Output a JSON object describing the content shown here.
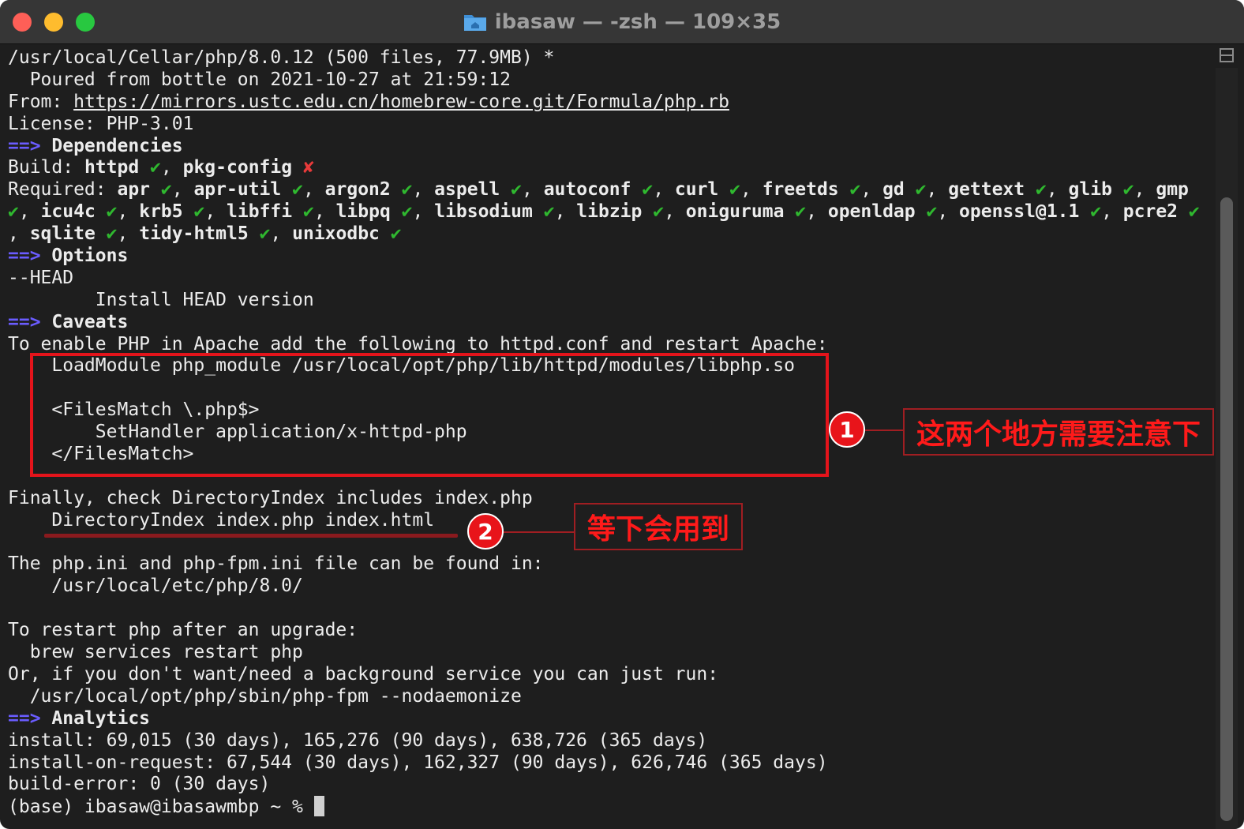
{
  "window": {
    "title": "ibasaw — -zsh — 109×35"
  },
  "terminal": {
    "lines": [
      [
        {
          "t": "/usr/local/Cellar/php/8.0.12 (500 files, 77.9MB) *"
        }
      ],
      [
        {
          "t": "  Poured from bottle on 2021-10-27 at 21:59:12"
        }
      ],
      [
        {
          "t": "From: "
        },
        {
          "t": "https://mirrors.ustc.edu.cn/homebrew-core.git/Formula/php.rb",
          "c": "u"
        }
      ],
      [
        {
          "t": "License: PHP-3.01"
        }
      ],
      [
        {
          "t": "==>",
          "c": "arrow"
        },
        {
          "t": " Dependencies",
          "c": "b"
        }
      ],
      [
        {
          "t": "Build: "
        },
        {
          "t": "httpd",
          "c": "b"
        },
        {
          "t": " "
        },
        {
          "t": "✔",
          "c": "ok"
        },
        {
          "t": ", "
        },
        {
          "t": "pkg-config",
          "c": "b"
        },
        {
          "t": " "
        },
        {
          "t": "✘",
          "c": "x"
        }
      ],
      [
        {
          "t": "Required: "
        },
        {
          "t": "apr",
          "c": "b"
        },
        {
          "t": " "
        },
        {
          "t": "✔",
          "c": "ok"
        },
        {
          "t": ", "
        },
        {
          "t": "apr-util",
          "c": "b"
        },
        {
          "t": " "
        },
        {
          "t": "✔",
          "c": "ok"
        },
        {
          "t": ", "
        },
        {
          "t": "argon2",
          "c": "b"
        },
        {
          "t": " "
        },
        {
          "t": "✔",
          "c": "ok"
        },
        {
          "t": ", "
        },
        {
          "t": "aspell",
          "c": "b"
        },
        {
          "t": " "
        },
        {
          "t": "✔",
          "c": "ok"
        },
        {
          "t": ", "
        },
        {
          "t": "autoconf",
          "c": "b"
        },
        {
          "t": " "
        },
        {
          "t": "✔",
          "c": "ok"
        },
        {
          "t": ", "
        },
        {
          "t": "curl",
          "c": "b"
        },
        {
          "t": " "
        },
        {
          "t": "✔",
          "c": "ok"
        },
        {
          "t": ", "
        },
        {
          "t": "freetds",
          "c": "b"
        },
        {
          "t": " "
        },
        {
          "t": "✔",
          "c": "ok"
        },
        {
          "t": ", "
        },
        {
          "t": "gd",
          "c": "b"
        },
        {
          "t": " "
        },
        {
          "t": "✔",
          "c": "ok"
        },
        {
          "t": ", "
        },
        {
          "t": "gettext",
          "c": "b"
        },
        {
          "t": " "
        },
        {
          "t": "✔",
          "c": "ok"
        },
        {
          "t": ", "
        },
        {
          "t": "glib",
          "c": "b"
        },
        {
          "t": " "
        },
        {
          "t": "✔",
          "c": "ok"
        },
        {
          "t": ", "
        },
        {
          "t": "gmp",
          "c": "b"
        }
      ],
      [
        {
          "t": "✔",
          "c": "ok"
        },
        {
          "t": ", "
        },
        {
          "t": "icu4c",
          "c": "b"
        },
        {
          "t": " "
        },
        {
          "t": "✔",
          "c": "ok"
        },
        {
          "t": ", "
        },
        {
          "t": "krb5",
          "c": "b"
        },
        {
          "t": " "
        },
        {
          "t": "✔",
          "c": "ok"
        },
        {
          "t": ", "
        },
        {
          "t": "libffi",
          "c": "b"
        },
        {
          "t": " "
        },
        {
          "t": "✔",
          "c": "ok"
        },
        {
          "t": ", "
        },
        {
          "t": "libpq",
          "c": "b"
        },
        {
          "t": " "
        },
        {
          "t": "✔",
          "c": "ok"
        },
        {
          "t": ", "
        },
        {
          "t": "libsodium",
          "c": "b"
        },
        {
          "t": " "
        },
        {
          "t": "✔",
          "c": "ok"
        },
        {
          "t": ", "
        },
        {
          "t": "libzip",
          "c": "b"
        },
        {
          "t": " "
        },
        {
          "t": "✔",
          "c": "ok"
        },
        {
          "t": ", "
        },
        {
          "t": "oniguruma",
          "c": "b"
        },
        {
          "t": " "
        },
        {
          "t": "✔",
          "c": "ok"
        },
        {
          "t": ", "
        },
        {
          "t": "openldap",
          "c": "b"
        },
        {
          "t": " "
        },
        {
          "t": "✔",
          "c": "ok"
        },
        {
          "t": ", "
        },
        {
          "t": "openssl@1.1",
          "c": "b"
        },
        {
          "t": " "
        },
        {
          "t": "✔",
          "c": "ok"
        },
        {
          "t": ", "
        },
        {
          "t": "pcre2",
          "c": "b"
        },
        {
          "t": " "
        },
        {
          "t": "✔",
          "c": "ok"
        }
      ],
      [
        {
          "t": ", "
        },
        {
          "t": "sqlite",
          "c": "b"
        },
        {
          "t": " "
        },
        {
          "t": "✔",
          "c": "ok"
        },
        {
          "t": ", "
        },
        {
          "t": "tidy-html5",
          "c": "b"
        },
        {
          "t": " "
        },
        {
          "t": "✔",
          "c": "ok"
        },
        {
          "t": ", "
        },
        {
          "t": "unixodbc",
          "c": "b"
        },
        {
          "t": " "
        },
        {
          "t": "✔",
          "c": "ok"
        }
      ],
      [
        {
          "t": "==>",
          "c": "arrow"
        },
        {
          "t": " Options",
          "c": "b"
        }
      ],
      [
        {
          "t": "--HEAD"
        }
      ],
      [
        {
          "t": "        Install HEAD version"
        }
      ],
      [
        {
          "t": "==>",
          "c": "arrow"
        },
        {
          "t": " Caveats",
          "c": "b"
        }
      ],
      [
        {
          "t": "To enable PHP in Apache add the following to httpd.conf and restart Apache:"
        }
      ],
      [
        {
          "t": "    LoadModule php_module /usr/local/opt/php/lib/httpd/modules/libphp.so"
        }
      ],
      [
        {
          "t": ""
        }
      ],
      [
        {
          "t": "    <FilesMatch \\.php$>"
        }
      ],
      [
        {
          "t": "        SetHandler application/x-httpd-php"
        }
      ],
      [
        {
          "t": "    </FilesMatch>"
        }
      ],
      [
        {
          "t": ""
        }
      ],
      [
        {
          "t": "Finally, check DirectoryIndex includes index.php"
        }
      ],
      [
        {
          "t": "    DirectoryIndex index.php index.html"
        }
      ],
      [
        {
          "t": ""
        }
      ],
      [
        {
          "t": "The php.ini and php-fpm.ini file can be found in:"
        }
      ],
      [
        {
          "t": "    /usr/local/etc/php/8.0/"
        }
      ],
      [
        {
          "t": ""
        }
      ],
      [
        {
          "t": "To restart php after an upgrade:"
        }
      ],
      [
        {
          "t": "  brew services restart php"
        }
      ],
      [
        {
          "t": "Or, if you don't want/need a background service you can just run:"
        }
      ],
      [
        {
          "t": "  /usr/local/opt/php/sbin/php-fpm --nodaemonize"
        }
      ],
      [
        {
          "t": "==>",
          "c": "arrow"
        },
        {
          "t": " Analytics",
          "c": "b"
        }
      ],
      [
        {
          "t": "install: 69,015 (30 days), 165,276 (90 days), 638,726 (365 days)"
        }
      ],
      [
        {
          "t": "install-on-request: 67,544 (30 days), 162,327 (90 days), 626,746 (365 days)"
        }
      ],
      [
        {
          "t": "build-error: 0 (30 days)"
        }
      ],
      [
        {
          "t": "(base) ibasaw@ibasawmbp ~ % "
        },
        {
          "t": "",
          "c": "cursor"
        }
      ]
    ]
  },
  "annotations": {
    "badge1": "1",
    "note1": "这两个地方需要注意下",
    "badge2": "2",
    "note2": "等下会用到"
  },
  "colors": {
    "arrow": "#6a5cff",
    "check": "#2fb82f",
    "cross": "#e83a3a",
    "highlight": "#e4141b"
  }
}
